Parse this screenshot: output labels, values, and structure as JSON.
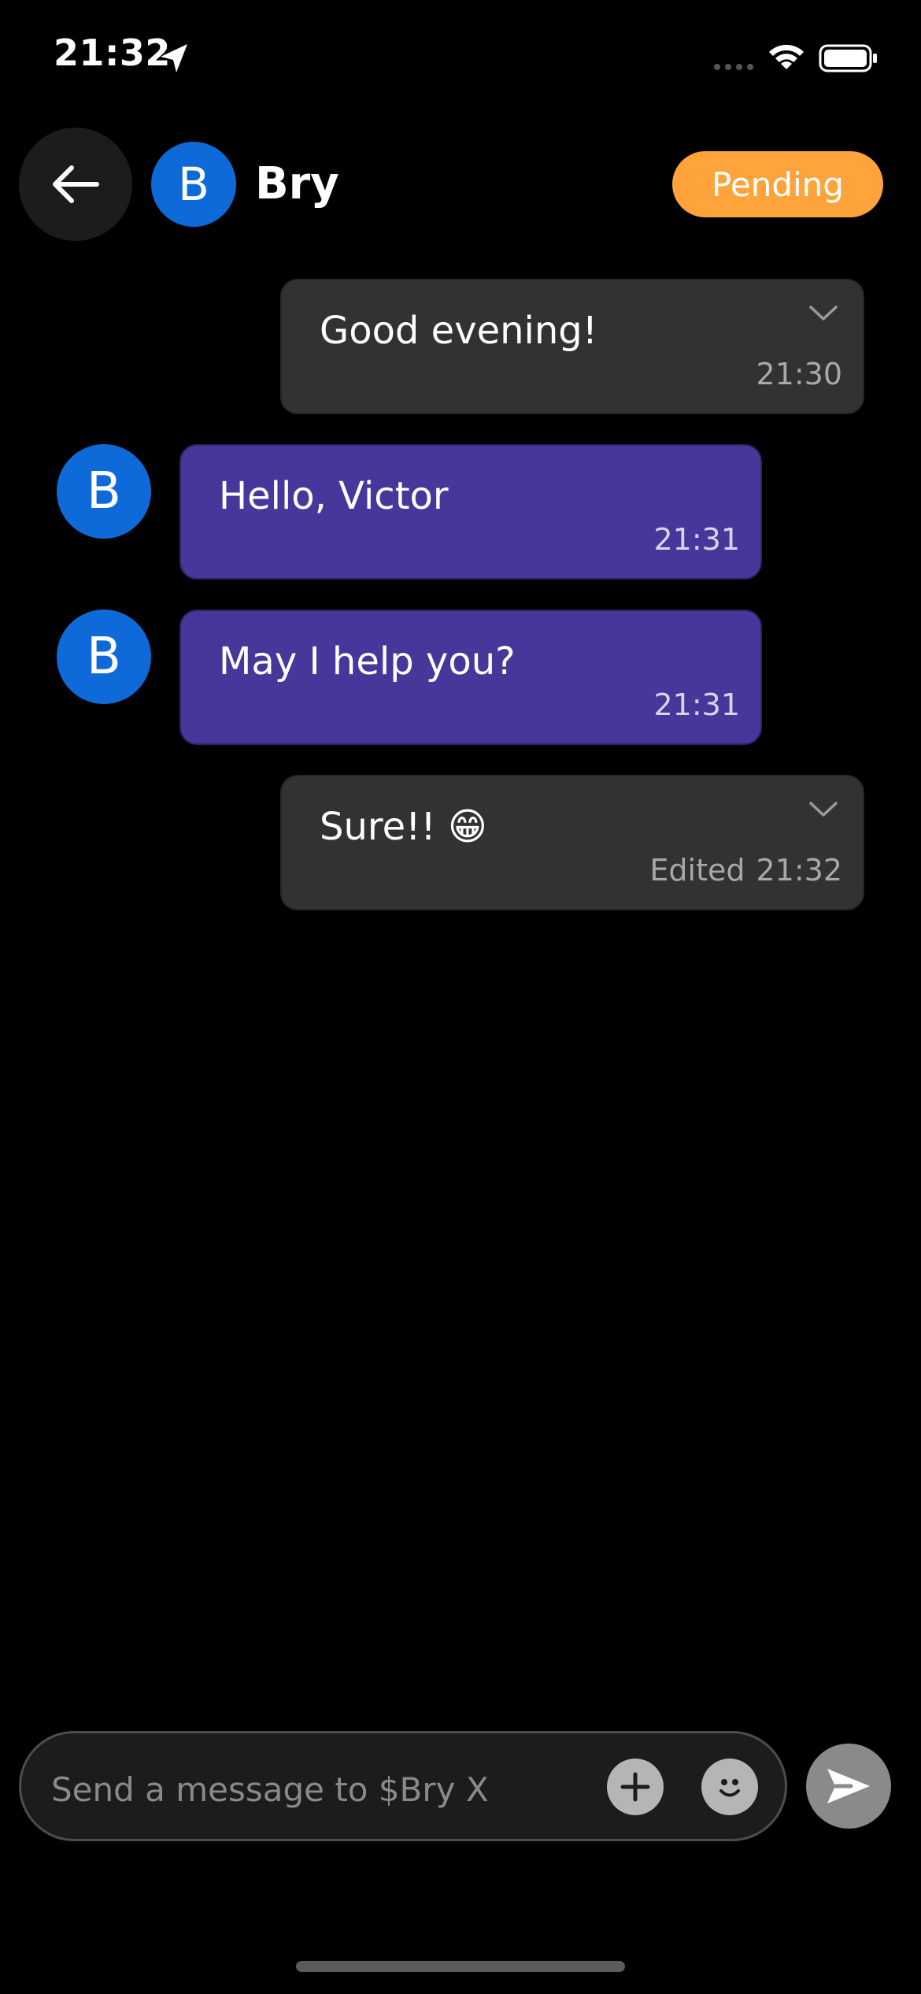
{
  "status_bar": {
    "time": "21:32",
    "icons": [
      "location-arrow-icon",
      "cellular-signal-icon",
      "wifi-icon",
      "battery-icon"
    ]
  },
  "header": {
    "back_icon": "arrow-left-icon",
    "avatar_initial": "B",
    "contact_name": "Bry",
    "status_label": "Pending"
  },
  "messages": [
    {
      "direction": "outgoing",
      "text": "Good evening!",
      "time": "21:30",
      "edited_label": ""
    },
    {
      "direction": "incoming",
      "avatar_initial": "B",
      "text": "Hello, Victor",
      "time": "21:31"
    },
    {
      "direction": "incoming",
      "avatar_initial": "B",
      "text": "May I help you?",
      "time": "21:31"
    },
    {
      "direction": "outgoing",
      "text": "Sure!! 😁",
      "time": "21:32",
      "edited_label": "Edited"
    }
  ],
  "composer": {
    "placeholder": "Send a message to $Bry X",
    "value": "",
    "add_icon": "plus-circle-icon",
    "emoji_icon": "smiley-icon",
    "send_icon": "send-arrow-icon"
  },
  "colors": {
    "background": "#000000",
    "outgoing_bubble": "#323232",
    "incoming_bubble": "#45389a",
    "avatar": "#0f6ad9",
    "pending_pill": "#ffa33a",
    "meta_text": "#a8a8a8"
  }
}
